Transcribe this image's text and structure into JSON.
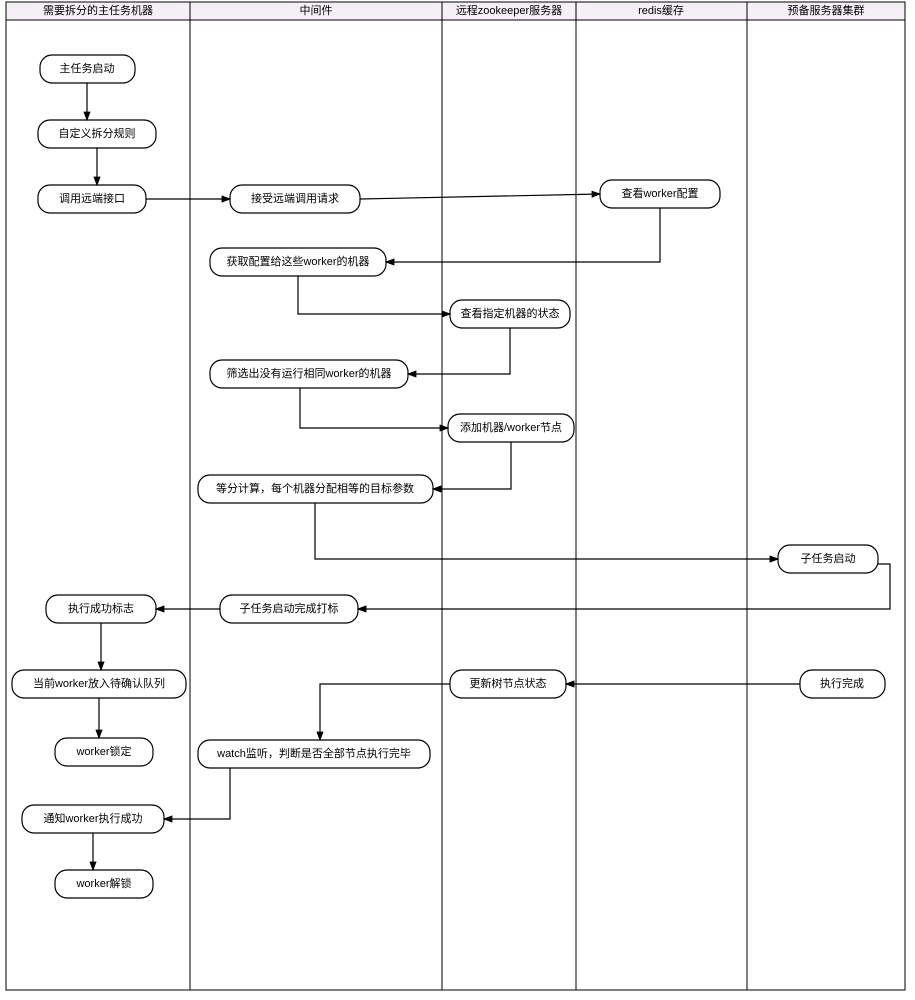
{
  "lanes": [
    {
      "id": "lane1",
      "title": "需要拆分的主任务机器"
    },
    {
      "id": "lane2",
      "title": "中间件"
    },
    {
      "id": "lane3",
      "title": "远程zookeeper服务器"
    },
    {
      "id": "lane4",
      "title": "redis缓存"
    },
    {
      "id": "lane5",
      "title": "预备服务器集群"
    }
  ],
  "nodes": {
    "n1": "主任务启动",
    "n2": "自定义拆分规则",
    "n3": "调用远端接口",
    "n4": "接受远端调用请求",
    "n5": "查看worker配置",
    "n6": "获取配置给这些worker的机器",
    "n7": "查看指定机器的状态",
    "n8": "筛选出没有运行相同worker的机器",
    "n9": "添加机器/worker节点",
    "n10": "等分计算，每个机器分配相等的目标参数",
    "n11": "子任务启动",
    "n12": "子任务启动完成打标",
    "n13": "执行成功标志",
    "n14": "当前worker放入待确认队列",
    "n15": "执行完成",
    "n16": "更新树节点状态",
    "n17": "worker锁定",
    "n18": "watch监听，判断是否全部节点执行完毕",
    "n19": "通知worker执行成功",
    "n20": "worker解锁"
  },
  "chart_data": {
    "type": "activity-diagram-swimlane",
    "swimlanes": [
      "需要拆分的主任务机器",
      "中间件",
      "远程zookeeper服务器",
      "redis缓存",
      "预备服务器集群"
    ],
    "activities": [
      {
        "id": "n1",
        "lane": 0,
        "label": "主任务启动"
      },
      {
        "id": "n2",
        "lane": 0,
        "label": "自定义拆分规则"
      },
      {
        "id": "n3",
        "lane": 0,
        "label": "调用远端接口"
      },
      {
        "id": "n4",
        "lane": 1,
        "label": "接受远端调用请求"
      },
      {
        "id": "n5",
        "lane": 3,
        "label": "查看worker配置"
      },
      {
        "id": "n6",
        "lane": 1,
        "label": "获取配置给这些worker的机器"
      },
      {
        "id": "n7",
        "lane": 2,
        "label": "查看指定机器的状态"
      },
      {
        "id": "n8",
        "lane": 1,
        "label": "筛选出没有运行相同worker的机器"
      },
      {
        "id": "n9",
        "lane": 2,
        "label": "添加机器/worker节点"
      },
      {
        "id": "n10",
        "lane": 1,
        "label": "等分计算，每个机器分配相等的目标参数"
      },
      {
        "id": "n11",
        "lane": 4,
        "label": "子任务启动"
      },
      {
        "id": "n12",
        "lane": 1,
        "label": "子任务启动完成打标"
      },
      {
        "id": "n13",
        "lane": 0,
        "label": "执行成功标志"
      },
      {
        "id": "n14",
        "lane": 0,
        "label": "当前worker放入待确认队列"
      },
      {
        "id": "n15",
        "lane": 4,
        "label": "执行完成"
      },
      {
        "id": "n16",
        "lane": 2,
        "label": "更新树节点状态"
      },
      {
        "id": "n17",
        "lane": 0,
        "label": "worker锁定"
      },
      {
        "id": "n18",
        "lane": 1,
        "label": "watch监听，判断是否全部节点执行完毕"
      },
      {
        "id": "n19",
        "lane": 0,
        "label": "通知worker执行成功"
      },
      {
        "id": "n20",
        "lane": 0,
        "label": "worker解锁"
      }
    ],
    "edges": [
      [
        "n1",
        "n2"
      ],
      [
        "n2",
        "n3"
      ],
      [
        "n3",
        "n4"
      ],
      [
        "n4",
        "n5"
      ],
      [
        "n5",
        "n6"
      ],
      [
        "n6",
        "n7"
      ],
      [
        "n7",
        "n8"
      ],
      [
        "n8",
        "n9"
      ],
      [
        "n9",
        "n10"
      ],
      [
        "n10",
        "n11"
      ],
      [
        "n11",
        "n12"
      ],
      [
        "n12",
        "n13"
      ],
      [
        "n13",
        "n14"
      ],
      [
        "n14",
        "n17"
      ],
      [
        "n15",
        "n16"
      ],
      [
        "n16",
        "n18"
      ],
      [
        "n18",
        "n19"
      ],
      [
        "n19",
        "n20"
      ]
    ]
  }
}
